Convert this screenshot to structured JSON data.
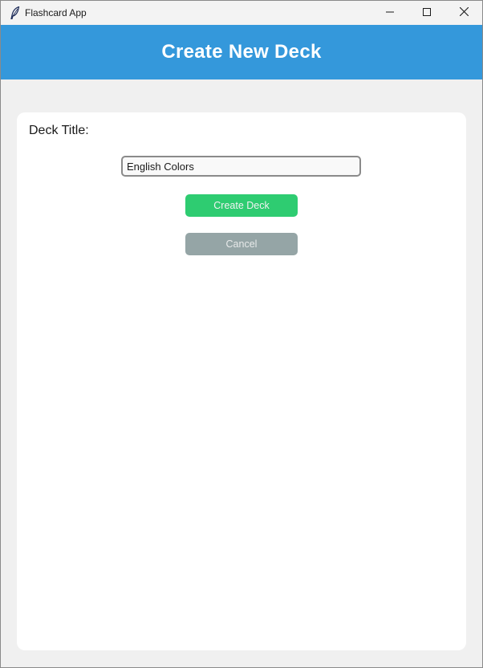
{
  "window": {
    "title": "Flashcard App",
    "icon": "feather-icon",
    "controls": [
      "minimize-icon",
      "maximize-icon",
      "close-icon"
    ]
  },
  "header": {
    "title": "Create New Deck",
    "background": "#3498db"
  },
  "form": {
    "deck_title_label": "Deck Title:",
    "deck_title_value": "English Colors",
    "create_label": "Create Deck",
    "cancel_label": "Cancel"
  },
  "colors": {
    "create_button": "#2ecc71",
    "cancel_button": "#95a5a6",
    "page_background": "#f0f0f0",
    "card_background": "#ffffff"
  }
}
